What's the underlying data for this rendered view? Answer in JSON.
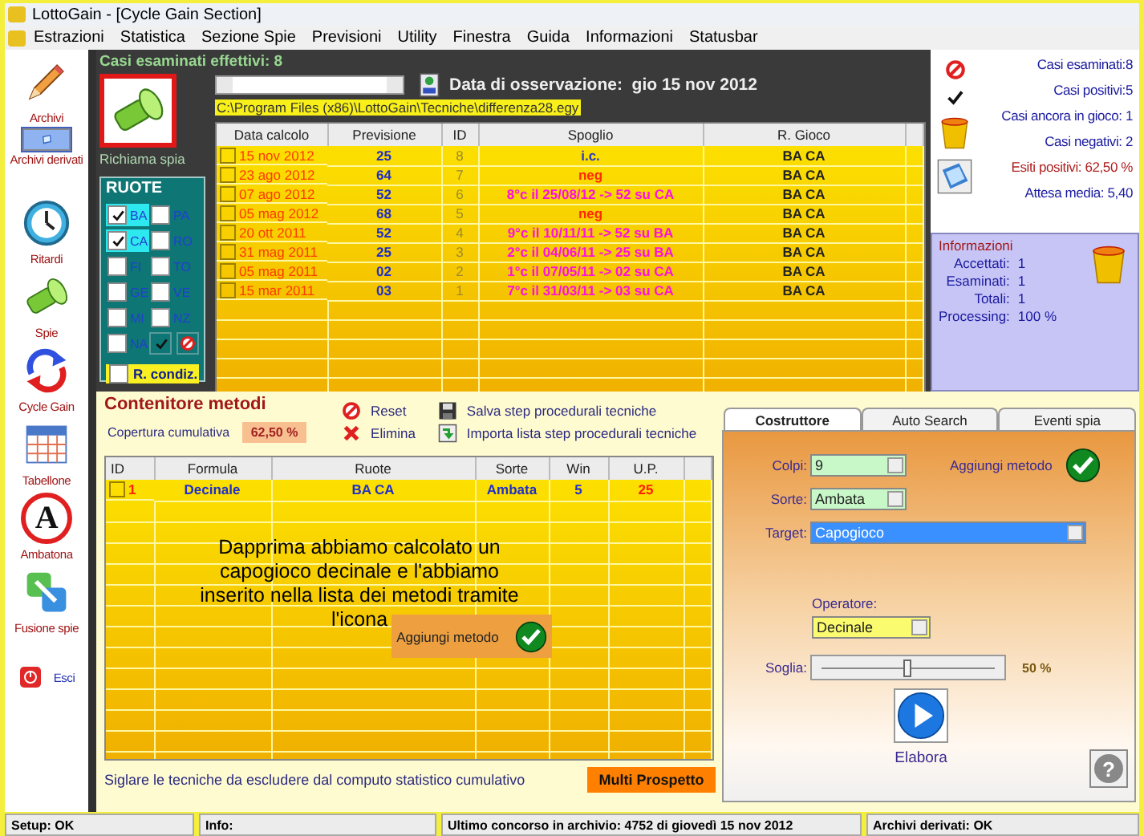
{
  "window": {
    "title": "LottoGain - [Cycle Gain Section]"
  },
  "menu": [
    "Estrazioni",
    "Statistica",
    "Sezione Spie",
    "Previsioni",
    "Utility",
    "Finestra",
    "Guida",
    "Informazioni",
    "Statusbar"
  ],
  "sidebar": {
    "items": [
      {
        "label": "Archivi",
        "kind": "stacked",
        "selected": false
      },
      {
        "label": "Archivi derivati",
        "kind": "stacked",
        "selected": true
      },
      {
        "label": "Ritardi",
        "kind": "stacked",
        "selected": false
      },
      {
        "label": "Spie",
        "kind": "stacked",
        "selected": false
      },
      {
        "label": "Cycle Gain",
        "kind": "stacked",
        "selected": false
      },
      {
        "label": "Tabellone",
        "kind": "stacked",
        "selected": false
      },
      {
        "label": "Ambatona",
        "kind": "stacked",
        "selected": false,
        "icon_text": "A"
      },
      {
        "label": "Fusione spie",
        "kind": "stacked",
        "selected": false
      },
      {
        "label": "Esci",
        "kind": "inline",
        "selected": false
      }
    ]
  },
  "spy_panel": {
    "heading": "Casi esaminati effettivi: 8",
    "recall_label": "Richiama spia",
    "ruote": {
      "title": "RUOTE",
      "items": [
        {
          "label": "BA",
          "checked": true,
          "selected": true
        },
        {
          "label": "PA",
          "checked": false,
          "selected": false
        },
        {
          "label": "CA",
          "checked": true,
          "selected": true
        },
        {
          "label": "RO",
          "checked": false,
          "selected": false
        },
        {
          "label": "FI",
          "checked": false,
          "selected": false
        },
        {
          "label": "TO",
          "checked": false,
          "selected": false
        },
        {
          "label": "GE",
          "checked": false,
          "selected": false
        },
        {
          "label": "VE",
          "checked": false,
          "selected": false
        },
        {
          "label": "MI",
          "checked": false,
          "selected": false
        },
        {
          "label": "NZ",
          "checked": false,
          "selected": false
        },
        {
          "label": "NA",
          "checked": false,
          "selected": false
        }
      ],
      "condition": {
        "label": "R. condiz.",
        "checked": false
      }
    }
  },
  "observation": {
    "date_label": "Data di osservazione:  gio 15 nov 2012",
    "path": "C:\\Program Files (x86)\\LottoGain\\Tecniche\\differenza28.egy"
  },
  "cases_table": {
    "columns": [
      "Data calcolo",
      "Previsione",
      "ID",
      "Spoglio",
      "R. Gioco"
    ],
    "rows": [
      {
        "checked": false,
        "date": "15 nov 2012",
        "forecast": "25",
        "id": "8",
        "color": "#2838c8",
        "result": "i.c.",
        "wheels": "BA CA"
      },
      {
        "checked": false,
        "date": "23 ago 2012",
        "forecast": "64",
        "id": "7",
        "color": "#ff2a00",
        "result": "neg",
        "wheels": "BA CA"
      },
      {
        "checked": false,
        "date": "07 ago 2012",
        "forecast": "52",
        "id": "6",
        "color": "#ff10e0",
        "result": "8°c il 25/08/12 -> 52 su CA",
        "wheels": "BA CA"
      },
      {
        "checked": false,
        "date": "05 mag 2012",
        "forecast": "68",
        "id": "5",
        "color": "#ff2a00",
        "result": "neg",
        "wheels": "BA CA"
      },
      {
        "checked": false,
        "date": "20 ott 2011",
        "forecast": "52",
        "id": "4",
        "color": "#ff10e0",
        "result": "9°c il 10/11/11 -> 52 su BA",
        "wheels": "BA CA"
      },
      {
        "checked": false,
        "date": "31 mag 2011",
        "forecast": "25",
        "id": "3",
        "color": "#ff10e0",
        "result": "2°c il 04/06/11 -> 25 su BA",
        "wheels": "BA CA"
      },
      {
        "checked": false,
        "date": "05 mag 2011",
        "forecast": "02",
        "id": "2",
        "color": "#ff10e0",
        "result": "1°c il 07/05/11 -> 02 su CA",
        "wheels": "BA CA"
      },
      {
        "checked": false,
        "date": "15 mar 2011",
        "forecast": "03",
        "id": "1",
        "color": "#ff10e0",
        "result": "7°c il 31/03/11 -> 03 su CA",
        "wheels": "BA CA"
      }
    ]
  },
  "stats": [
    {
      "text": "Casi esaminati:8",
      "kind": "normal"
    },
    {
      "text": "Casi positivi:5",
      "kind": "normal"
    },
    {
      "text": "Casi ancora in gioco: 1",
      "kind": "normal"
    },
    {
      "text": "Casi negativi: 2",
      "kind": "normal"
    },
    {
      "text": "Esiti positivi: 62,50 %",
      "kind": "highlight"
    },
    {
      "text": "Attesa media: 5,40",
      "kind": "normal"
    }
  ],
  "info": {
    "title": "Informazioni",
    "lines": [
      {
        "label": "Accettati:",
        "value": "1"
      },
      {
        "label": "Esaminati:",
        "value": "1"
      },
      {
        "label": "Totali:",
        "value": "1"
      },
      {
        "label": "Processing:",
        "value": "100 %"
      }
    ]
  },
  "methods": {
    "title": "Contenitore metodi",
    "coverage_label": "Copertura cumulativa",
    "coverage_value": "62,50 %",
    "reset": "Reset",
    "delete": "Elimina",
    "save": "Salva step procedurali tecniche",
    "import": "Importa lista step procedurali tecniche",
    "columns": [
      "ID",
      "Formula",
      "Ruote",
      "Sorte",
      "Win",
      "U.P."
    ],
    "rows": [
      {
        "checked": false,
        "id": "1",
        "formula": "Decinale",
        "wheels": "BA CA",
        "sorte": "Ambata",
        "win": "5",
        "up": "25"
      }
    ],
    "note": "Dapprima abbiamo calcolato un capogioco decinale e l'abbiamo inserito nella lista dei metodi tramite l'icona",
    "add_button": "Aggiungi metodo",
    "footer": "Siglare le tecniche da escludere dal computo statistico cumulativo",
    "multi_button": "Multi Prospetto"
  },
  "builder": {
    "tabs": [
      {
        "label": "Costruttore",
        "selected": true
      },
      {
        "label": "Auto Search",
        "selected": false
      },
      {
        "label": "Eventi spia",
        "selected": false
      }
    ],
    "colpi": {
      "label": "Colpi:",
      "value": "9"
    },
    "sorte": {
      "label": "Sorte:",
      "value": "Ambata"
    },
    "target": {
      "label": "Target:",
      "value": "Capogioco"
    },
    "add_label": "Aggiungi metodo",
    "operator": {
      "label": "Operatore:",
      "value": "Decinale"
    },
    "threshold": {
      "label": "Soglia:",
      "level": 0.5,
      "reading": "50 %"
    },
    "run_label": "Elabora",
    "help": "?"
  },
  "status_bar": [
    "Setup: OK",
    "Info:",
    "Ultimo concorso in archivio: 4752 di giovedì 15 nov 2012",
    "Archivi derivati: OK"
  ]
}
